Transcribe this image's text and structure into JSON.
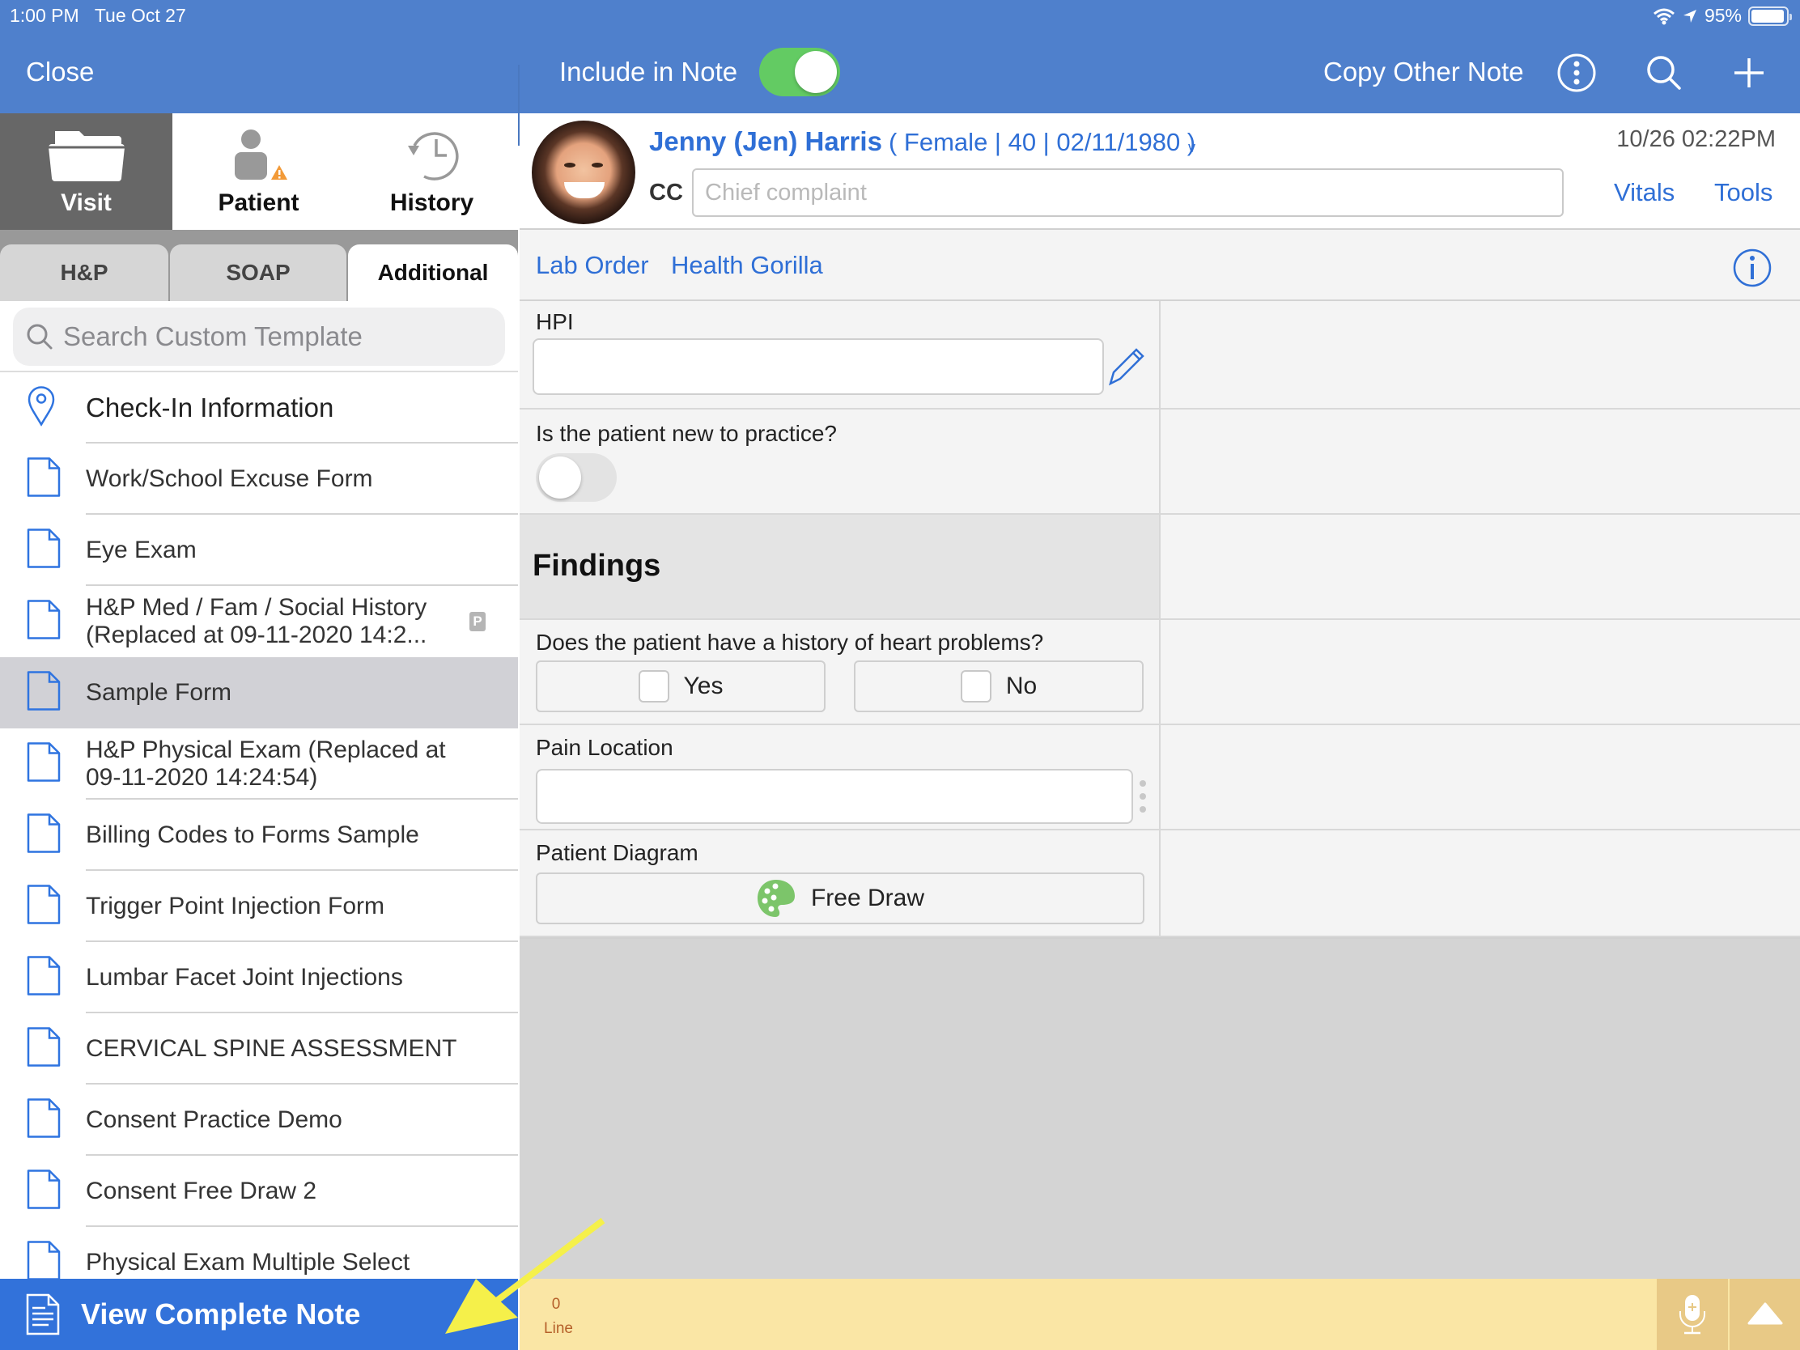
{
  "status_bar": {
    "time": "1:00 PM",
    "date": "Tue Oct 27",
    "battery": "95%"
  },
  "header": {
    "close_label": "Close",
    "include_in_note_label": "Include in Note",
    "include_in_note_on": true,
    "copy_other_note_label": "Copy Other Note",
    "icons": [
      "more-icon",
      "search-icon",
      "plus-icon"
    ]
  },
  "nav_tabs": [
    {
      "label": "Visit",
      "icon": "folder-icon",
      "active": true
    },
    {
      "label": "Patient",
      "icon": "person-warning-icon",
      "active": false
    },
    {
      "label": "History",
      "icon": "history-clock-icon",
      "active": false
    }
  ],
  "segments": [
    {
      "label": "H&P",
      "active": false
    },
    {
      "label": "SOAP",
      "active": false
    },
    {
      "label": "Additional",
      "active": true
    }
  ],
  "search": {
    "placeholder": "Search Custom Template",
    "value": ""
  },
  "templates": [
    {
      "label": "Check-In Information",
      "icon": "location-pin-icon"
    },
    {
      "label": "Work/School Excuse Form",
      "icon": "document-icon"
    },
    {
      "label": "Eye Exam",
      "icon": "document-icon"
    },
    {
      "label": "H&P Med / Fam / Social History (Replaced at 09-11-2020 14:2...",
      "icon": "document-icon",
      "badge": "P"
    },
    {
      "label": "Sample Form",
      "icon": "document-icon",
      "selected": true
    },
    {
      "label": "H&P Physical Exam (Replaced at 09-11-2020 14:24:54)",
      "icon": "document-icon"
    },
    {
      "label": "Billing Codes to Forms Sample",
      "icon": "document-icon"
    },
    {
      "label": "Trigger Point Injection Form",
      "icon": "document-icon"
    },
    {
      "label": "Lumbar Facet Joint Injections",
      "icon": "document-icon"
    },
    {
      "label": "CERVICAL SPINE ASSESSMENT",
      "icon": "document-icon"
    },
    {
      "label": "Consent Practice Demo",
      "icon": "document-icon"
    },
    {
      "label": "Consent Free Draw 2",
      "icon": "document-icon"
    },
    {
      "label": "Physical Exam Multiple Select",
      "icon": "document-icon"
    }
  ],
  "view_complete_note_label": "View Complete Note",
  "patient": {
    "name": "Jenny (Jen) Harris",
    "info": "( Female | 40 | 02/11/1980 )",
    "caret": "v",
    "visit_time": "10/26 02:22PM",
    "cc_label": "CC",
    "cc_placeholder": "Chief complaint",
    "cc_value": "",
    "vitals_label": "Vitals",
    "tools_label": "Tools"
  },
  "links": {
    "lab_order": "Lab Order",
    "health_gorilla": "Health Gorilla"
  },
  "form": {
    "hpi_label": "HPI",
    "hpi_value": "",
    "new_patient_label": "Is the patient new to practice?",
    "new_patient_on": false,
    "findings_label": "Findings",
    "heart_label": "Does the patient have a history of heart problems?",
    "heart_options": [
      {
        "label": "Yes",
        "checked": false
      },
      {
        "label": "No",
        "checked": false
      }
    ],
    "pain_label": "Pain Location",
    "pain_value": "",
    "diagram_label": "Patient Diagram",
    "free_draw_label": "Free Draw"
  },
  "footer": {
    "line_count": "0",
    "line_label": "Line"
  },
  "colors": {
    "header_blue": "#4F80CC",
    "link_blue": "#2F6FD6",
    "toggle_green": "#63CB63",
    "bottom_blue": "#3272DA",
    "footer_yellow": "#FAE6A5",
    "annotation_arrow": "#F5F04A"
  }
}
